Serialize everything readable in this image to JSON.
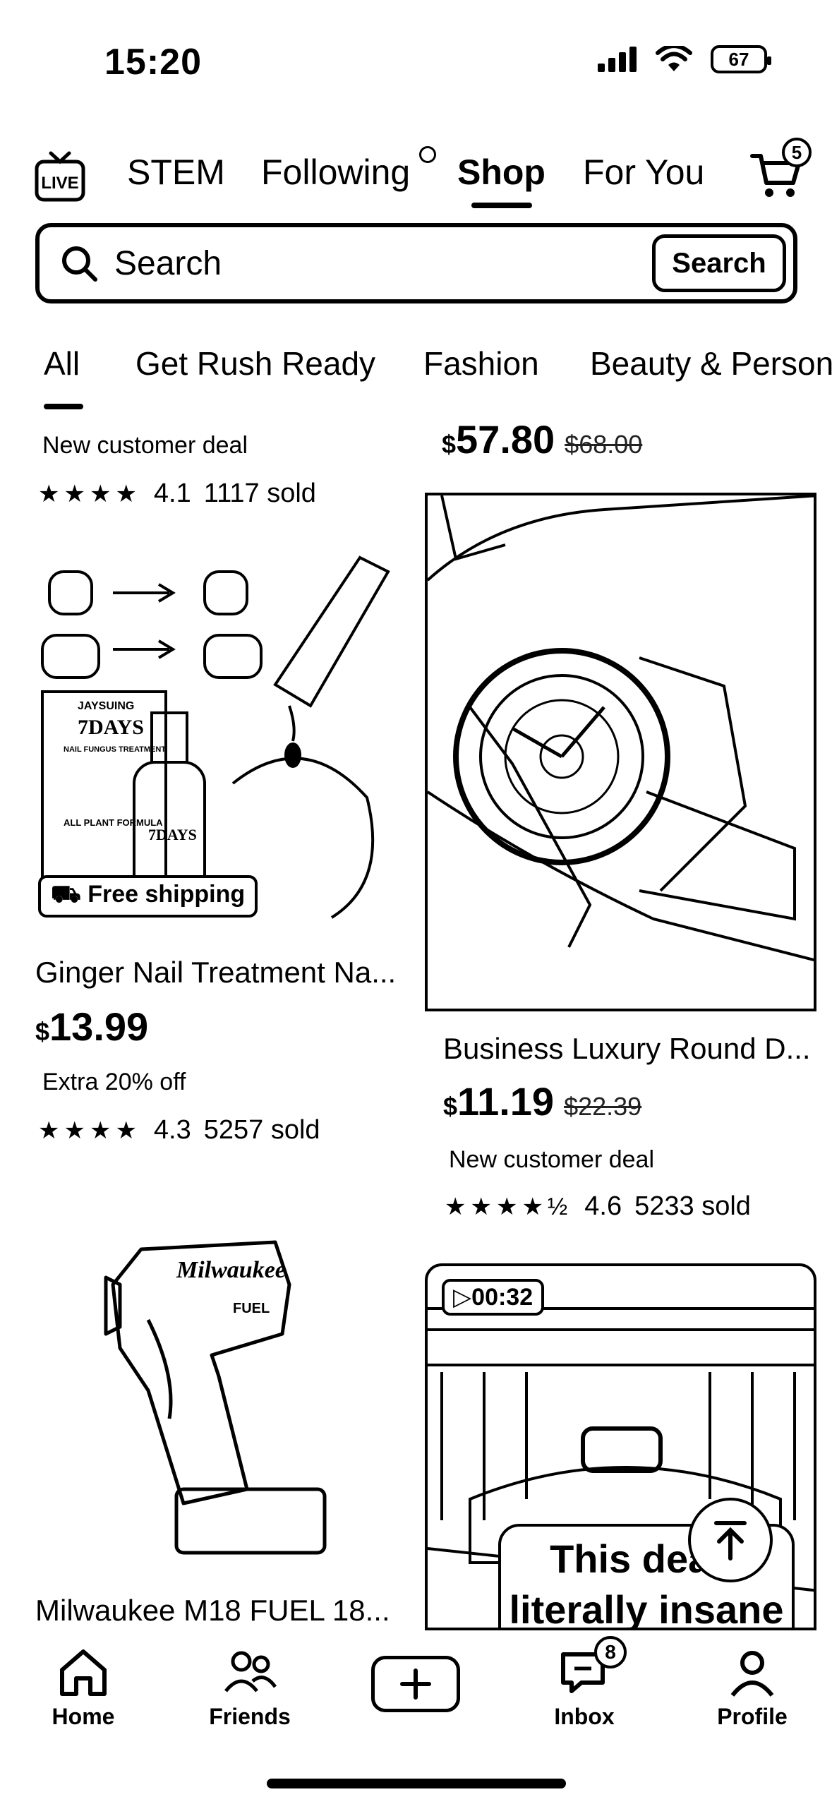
{
  "status": {
    "time": "15:20",
    "battery": "67"
  },
  "top_tabs": [
    {
      "label": "STEM"
    },
    {
      "label": "Following"
    },
    {
      "label": "Shop"
    },
    {
      "label": "For You"
    }
  ],
  "cart": {
    "badge": "5"
  },
  "search": {
    "placeholder": "Search",
    "button": "Search"
  },
  "category_tabs": [
    "All",
    "Get Rush Ready",
    "Fashion",
    "Beauty & Person"
  ],
  "products": [
    {
      "deal": "New customer deal",
      "rating": "4.1",
      "sold": "1117 sold"
    },
    {
      "price_sign": "$",
      "price": "57.80",
      "old_price": "$68.00"
    },
    {
      "badge": "Free shipping",
      "title": "Ginger Nail Treatment Na...",
      "price_sign": "$",
      "price": "13.99",
      "deal": "Extra 20% off",
      "rating": "4.3",
      "sold": "5257 sold",
      "image_text": {
        "brand": "JAYSUING",
        "headline": "7DAYS",
        "sub": "NAIL FUNGUS TREATMENT",
        "formula": "ALL PLANT FORMULA"
      }
    },
    {
      "title": "Business Luxury Round D...",
      "price_sign": "$",
      "price": "11.19",
      "old_price": "$22.39",
      "deal": "New customer deal",
      "rating": "4.6",
      "sold": "5233 sold"
    },
    {
      "title": "Milwaukee M18 FUEL 18...",
      "image_text": {
        "brand": "Milwaukee",
        "model": "FUEL"
      }
    },
    {
      "video_time": "00:32",
      "caption_line1": "This deal i",
      "caption_line2": "literally insane"
    }
  ],
  "bottom_nav": [
    {
      "label": "Home"
    },
    {
      "label": "Friends"
    },
    {
      "label": "Inbox",
      "badge": "8"
    },
    {
      "label": "Profile"
    }
  ]
}
